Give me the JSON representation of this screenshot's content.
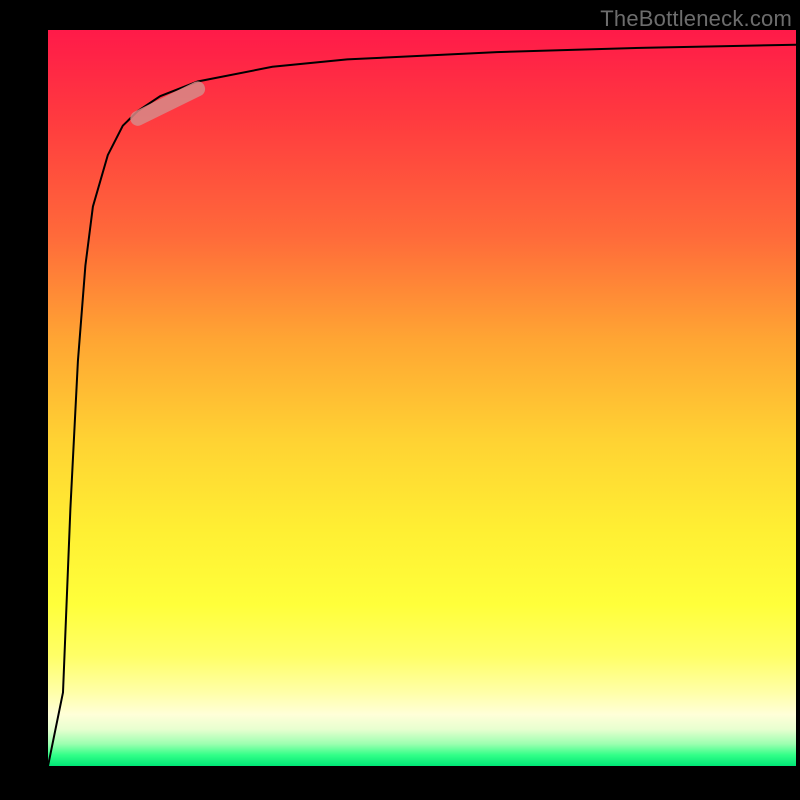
{
  "watermark": "TheBottleneck.com",
  "colors": {
    "frame": "#000000",
    "gradient_top": "#ff1a49",
    "gradient_mid": "#ffd333",
    "gradient_bottom": "#00e676",
    "curve": "#000000",
    "marker": "#d88a88"
  },
  "chart_data": {
    "type": "line",
    "title": "",
    "xlabel": "",
    "ylabel": "",
    "xlim": [
      0,
      100
    ],
    "ylim": [
      0,
      100
    ],
    "grid": false,
    "legend": false,
    "x": [
      0,
      2,
      3,
      4,
      5,
      6,
      8,
      10,
      12,
      15,
      20,
      30,
      40,
      50,
      60,
      70,
      80,
      90,
      100
    ],
    "y": [
      0,
      10,
      35,
      55,
      68,
      76,
      83,
      87,
      89,
      91,
      93,
      95,
      96,
      96.5,
      97,
      97.3,
      97.6,
      97.8,
      98
    ],
    "marker_segment": {
      "x0": 12,
      "y0": 88,
      "x1": 20,
      "y1": 92
    },
    "note": "x and y are percentages of axis range; curve is a steep-rise-then-plateau shape. No numeric axis labels are printed in the source image, so values are positional estimates."
  }
}
